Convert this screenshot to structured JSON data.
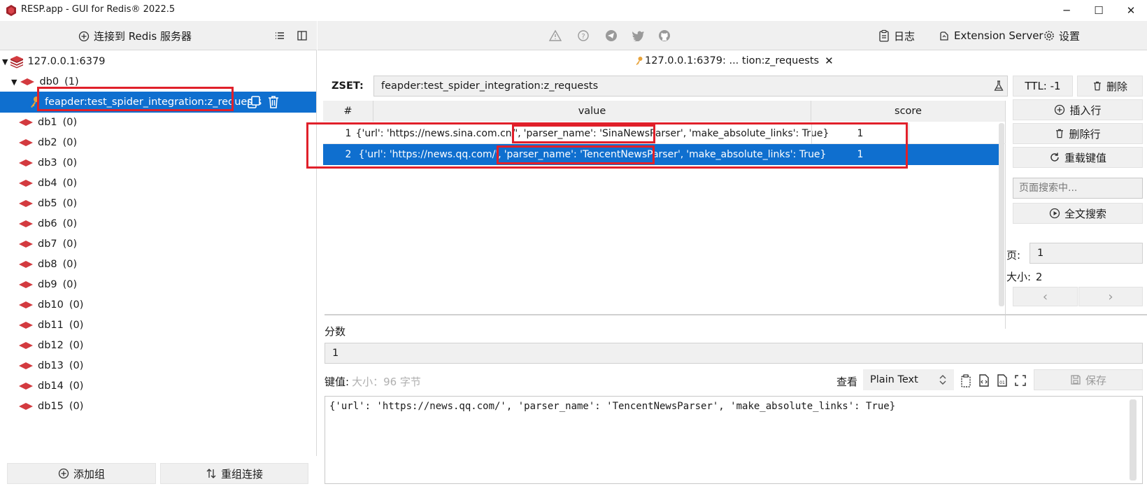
{
  "window": {
    "title": "RESP.app - GUI for Redis® 2022.5"
  },
  "left": {
    "toolbar": {
      "connect_label": "连接到 Redis 服务器"
    },
    "server": "127.0.0.1:6379",
    "db0": {
      "name": "db0",
      "count": "(1)"
    },
    "selected_key": "feapder:test_spider_integration:z_requests",
    "dbs": [
      {
        "name": "db1",
        "count": "(0)"
      },
      {
        "name": "db2",
        "count": "(0)"
      },
      {
        "name": "db3",
        "count": "(0)"
      },
      {
        "name": "db4",
        "count": "(0)"
      },
      {
        "name": "db5",
        "count": "(0)"
      },
      {
        "name": "db6",
        "count": "(0)"
      },
      {
        "name": "db7",
        "count": "(0)"
      },
      {
        "name": "db8",
        "count": "(0)"
      },
      {
        "name": "db9",
        "count": "(0)"
      },
      {
        "name": "db10",
        "count": "(0)"
      },
      {
        "name": "db11",
        "count": "(0)"
      },
      {
        "name": "db12",
        "count": "(0)"
      },
      {
        "name": "db13",
        "count": "(0)"
      },
      {
        "name": "db14",
        "count": "(0)"
      },
      {
        "name": "db15",
        "count": "(0)"
      }
    ],
    "bottom": {
      "add_group": "添加组",
      "regroup": "重组连接"
    }
  },
  "right": {
    "toolbar": {
      "log": "日志",
      "extension": "Extension Server",
      "settings": "设置"
    },
    "tab": {
      "label": "127.0.0.1:6379: ... tion:z_requests",
      "close": "✕"
    },
    "key": {
      "type": "ZSET:",
      "name": "feapder:test_spider_integration:z_requests",
      "ttl": "TTL:  -1",
      "delete": "删除"
    },
    "table": {
      "headers": {
        "index": "#",
        "value": "value",
        "score": "score"
      },
      "rows": [
        {
          "index": "1",
          "value_pre": "{'url': 'https://news.sina.com.cn/',",
          "value_mid": "'parser_name': 'SinaNewsParser',",
          "value_post": "'make_absolute_links': True}",
          "score": "1"
        },
        {
          "index": "2",
          "value_pre": "{'url': 'https://news.qq.com/',",
          "value_mid": "'parser_name': 'TencentNewsParser',",
          "value_post": "'make_absolute_links': True}",
          "score": "1"
        }
      ]
    },
    "side": {
      "insert_row": "插入行",
      "delete_row": "删除行",
      "reload": "重载键值",
      "search_placeholder": "页面搜索中...",
      "full_search": "全文搜索",
      "page_label": "页:",
      "page_value": "1",
      "size_label": "大小:",
      "size_value": "2",
      "prev": "‹",
      "next": "›"
    },
    "editor": {
      "score_label": "分数",
      "score_value": "1",
      "value_label": "键值:",
      "value_size": "大小：96 字节",
      "view_label": "查看",
      "view_mode": "Plain Text",
      "save": "保存",
      "content": "{'url': 'https://news.qq.com/', 'parser_name': 'TencentNewsParser', 'make_absolute_links': True}"
    }
  }
}
